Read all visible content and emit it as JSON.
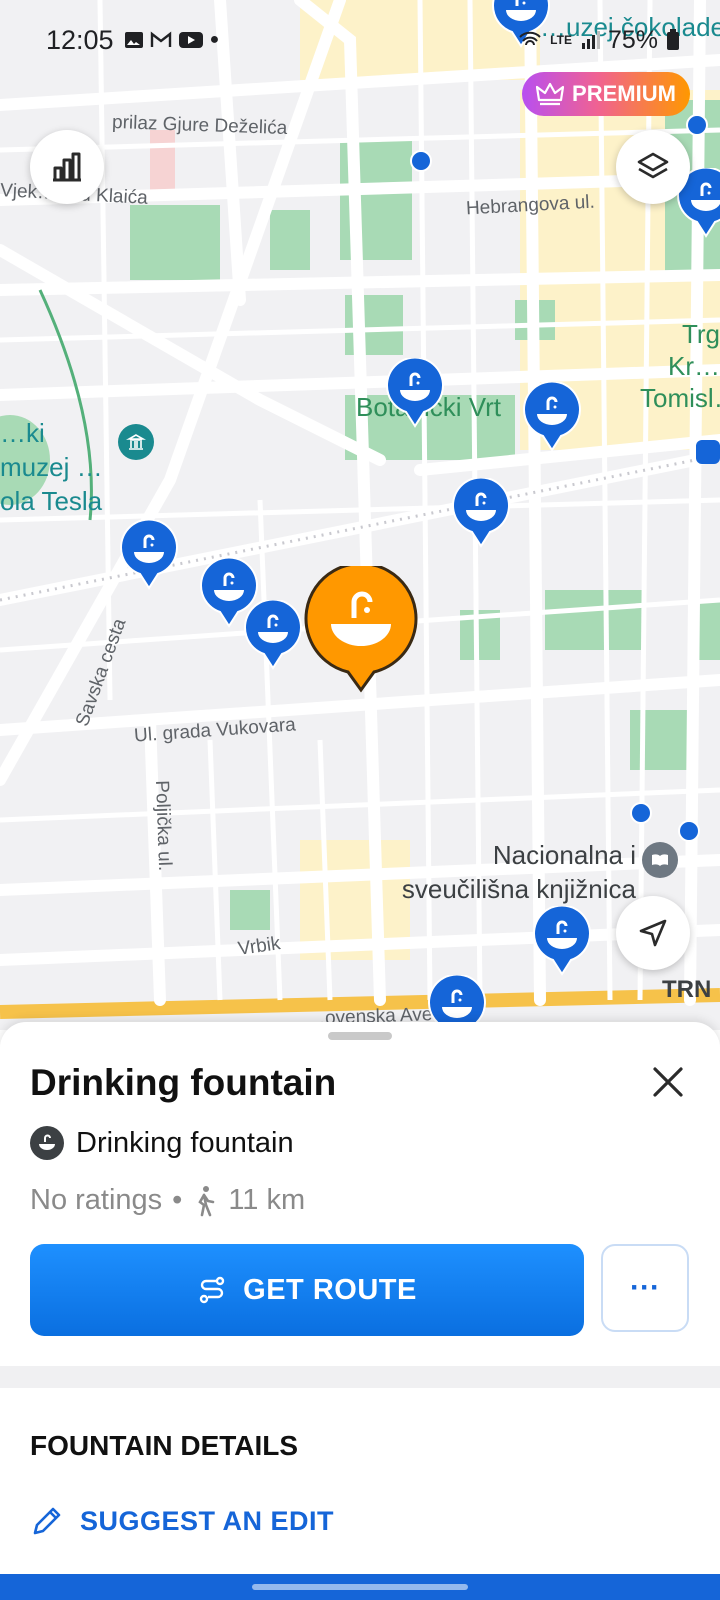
{
  "status_bar": {
    "time": "12:05",
    "network": "LTE",
    "battery": "75%"
  },
  "premium": {
    "label": "PREMIUM"
  },
  "map": {
    "labels": {
      "street1": "prilaz Gjure Deželića",
      "street2": "Vjek… …u Klaića",
      "street3": "Hebrangova ul.",
      "park1": "Botanički Vrt",
      "square": "Trg Kr… Tomisl…",
      "museum": "…ki muzej …ola Tesla",
      "museum2": "…uzej čokolade",
      "street4": "Savska cesta",
      "street5": "Ul. grada Vukovara",
      "street6": "Poljička ul.",
      "library": "Nacionalna i sveučilišna knjižnica",
      "area": "Vrbik",
      "area2": "TRN",
      "street7": "…ovenska Ave…"
    }
  },
  "sheet": {
    "title": "Drinking fountain",
    "category": "Drinking fountain",
    "ratings": "No ratings",
    "separator": "•",
    "distance": "11 km",
    "route_button": "GET ROUTE",
    "more_button": "···",
    "section_title": "FOUNTAIN DETAILS",
    "suggest_edit": "SUGGEST AN EDIT"
  },
  "colors": {
    "accent": "#1565d8",
    "selected_pin": "#ff9800",
    "park": "#a8dab5"
  },
  "icons": [
    "stats-icon",
    "layers-icon",
    "locate-icon",
    "close-icon",
    "fountain-icon",
    "walk-icon",
    "route-icon",
    "pencil-icon",
    "crown-icon"
  ]
}
